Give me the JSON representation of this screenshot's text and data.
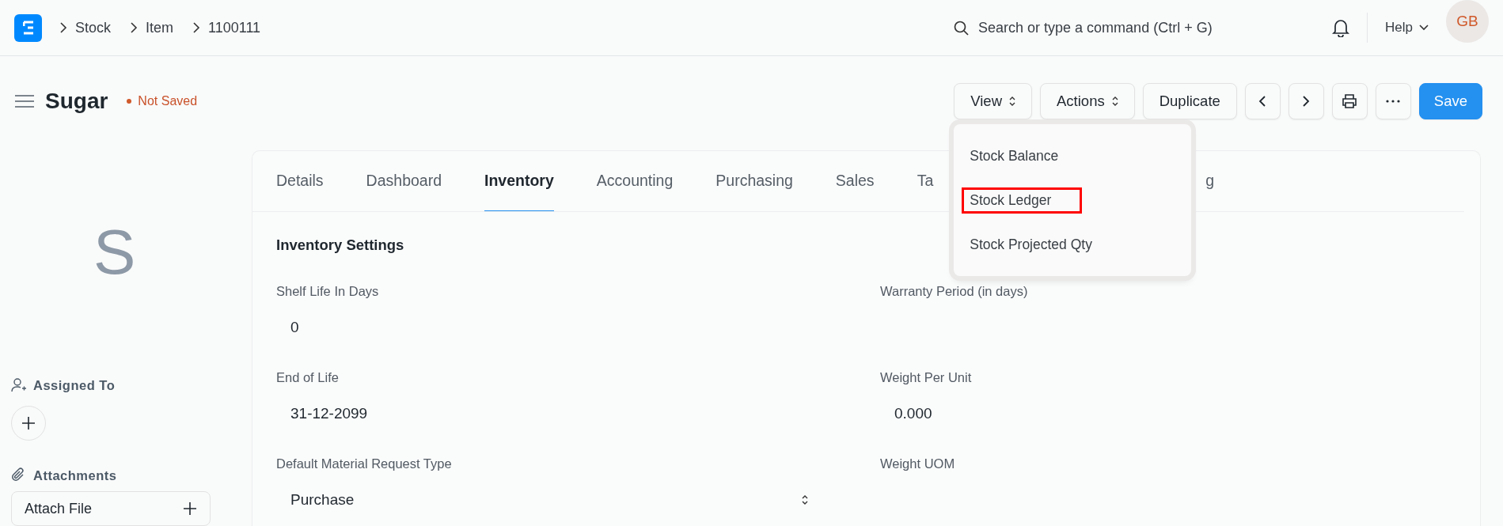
{
  "topbar": {
    "breadcrumbs": [
      "Stock",
      "Item",
      "1100111"
    ],
    "search": {
      "placeholder": "Search or type a command (Ctrl + G)"
    },
    "help": "Help",
    "avatar": "GB"
  },
  "page": {
    "title": "Sugar",
    "status": "Not Saved",
    "buttons": [
      {
        "kind": "menu",
        "label": "View"
      },
      {
        "kind": "menu",
        "label": "Actions"
      },
      {
        "kind": "text",
        "label": "Duplicate"
      },
      {
        "kind": "prev"
      },
      {
        "kind": "next"
      },
      {
        "kind": "print"
      },
      {
        "kind": "more"
      },
      {
        "kind": "primary",
        "label": "Save"
      }
    ]
  },
  "view_menu": {
    "items": [
      {
        "label": "Stock Balance",
        "highlighted": false
      },
      {
        "label": "Stock Ledger",
        "highlighted": true
      },
      {
        "label": "Stock Projected Qty",
        "highlighted": false
      }
    ]
  },
  "sidebar": {
    "avatar_letter": "S",
    "assigned_to": "Assigned To",
    "attachments": "Attachments",
    "attach_file": "Attach File"
  },
  "tabs": [
    {
      "label": "Details",
      "selected": false
    },
    {
      "label": "Dashboard",
      "selected": false
    },
    {
      "label": "Inventory",
      "selected": true
    },
    {
      "label": "Accounting",
      "selected": false
    },
    {
      "label": "Purchasing",
      "selected": false
    },
    {
      "label": "Sales",
      "selected": false
    },
    {
      "label": "Ta",
      "selected": false
    },
    {
      "label": "g",
      "selected": false
    }
  ],
  "section": {
    "title": "Inventory Settings",
    "fields": [
      {
        "label": "Shelf Life In Days",
        "value": "0",
        "kind": "input"
      },
      {
        "label": "Warranty Period (in days)",
        "kind": "input"
      },
      {
        "label": "End of Life",
        "value": "31-12-2099",
        "kind": "input"
      },
      {
        "label": "Weight Per Unit",
        "value": "0.000",
        "kind": "input"
      },
      {
        "label": "Default Material Request Type",
        "value": "Purchase",
        "kind": "select"
      },
      {
        "label": "Weight UOM",
        "kind": "input"
      }
    ]
  }
}
